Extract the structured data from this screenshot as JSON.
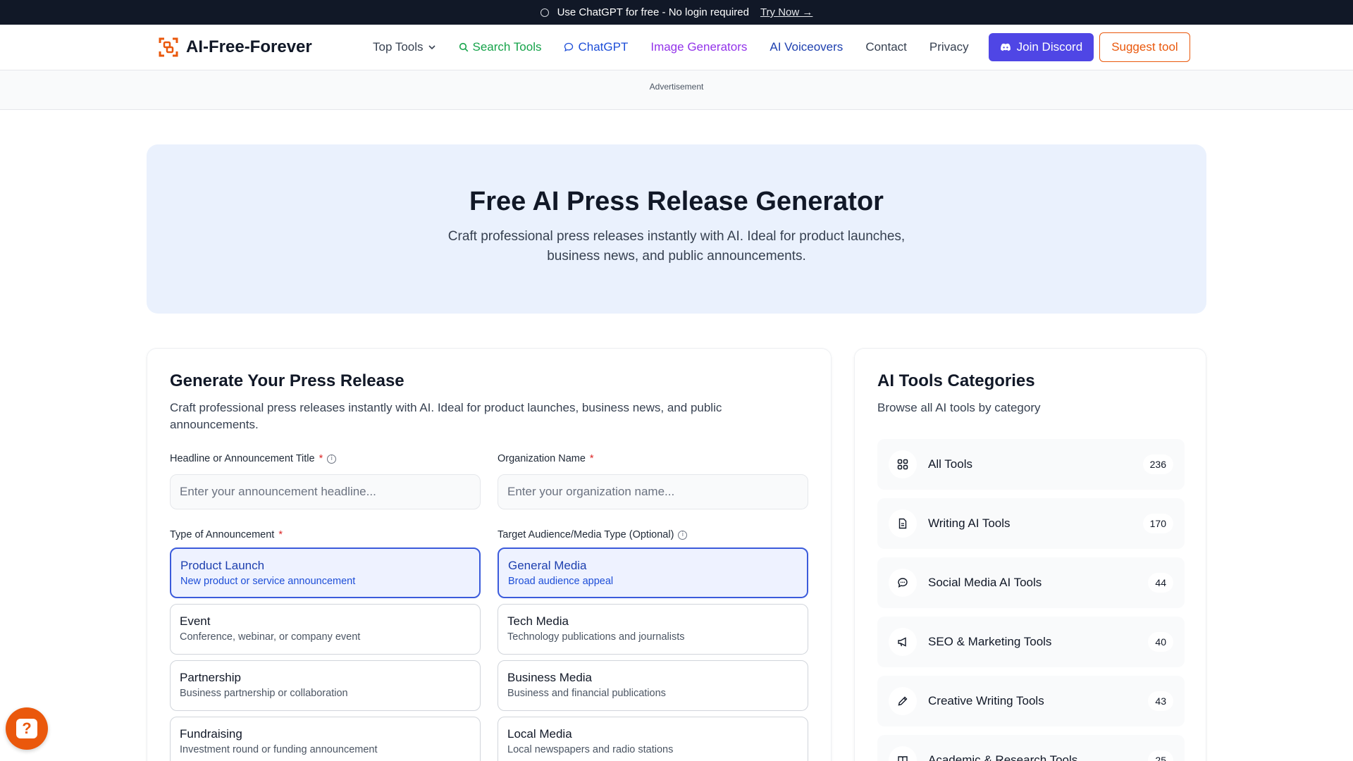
{
  "announcement": {
    "text": "Use ChatGPT for free - No login required",
    "link": "Try Now →"
  },
  "brand": {
    "name": "AI-Free-Forever",
    "accent": "#ea580c"
  },
  "nav": {
    "top_tools": "Top Tools",
    "search_tools": "Search Tools",
    "chatgpt": "ChatGPT",
    "image_generators": "Image Generators",
    "ai_voiceovers": "AI Voiceovers",
    "contact": "Contact",
    "privacy": "Privacy",
    "join_discord": "Join Discord",
    "suggest_tool": "Suggest tool"
  },
  "ad": {
    "label": "Advertisement"
  },
  "hero": {
    "title": "Free AI Press Release Generator",
    "subtitle": "Craft professional press releases instantly with AI. Ideal for product launches, business news, and public announcements."
  },
  "form": {
    "title": "Generate Your Press Release",
    "description": "Craft professional press releases instantly with AI. Ideal for product launches, business news, and public announcements.",
    "headline_label": "Headline or Announcement Title",
    "headline_placeholder": "Enter your announcement headline...",
    "org_label": "Organization Name",
    "org_placeholder": "Enter your organization name...",
    "required_mark": "*",
    "type_label": "Type of Announcement",
    "audience_label": "Target Audience/Media Type (Optional)",
    "announcement_types": [
      {
        "title": "Product Launch",
        "subtitle": "New product or service announcement",
        "selected": true
      },
      {
        "title": "Event",
        "subtitle": "Conference, webinar, or company event",
        "selected": false
      },
      {
        "title": "Partnership",
        "subtitle": "Business partnership or collaboration",
        "selected": false
      },
      {
        "title": "Fundraising",
        "subtitle": "Investment round or funding announcement",
        "selected": false
      }
    ],
    "audiences": [
      {
        "title": "General Media",
        "subtitle": "Broad audience appeal",
        "selected": true
      },
      {
        "title": "Tech Media",
        "subtitle": "Technology publications and journalists",
        "selected": false
      },
      {
        "title": "Business Media",
        "subtitle": "Business and financial publications",
        "selected": false
      },
      {
        "title": "Local Media",
        "subtitle": "Local newspapers and radio stations",
        "selected": false
      }
    ]
  },
  "categories": {
    "title": "AI Tools Categories",
    "subtitle": "Browse all AI tools by category",
    "items": [
      {
        "label": "All Tools",
        "count": "236",
        "icon": "grid-icon"
      },
      {
        "label": "Writing AI Tools",
        "count": "170",
        "icon": "document-icon"
      },
      {
        "label": "Social Media AI Tools",
        "count": "44",
        "icon": "chat-bubble-icon"
      },
      {
        "label": "SEO & Marketing Tools",
        "count": "40",
        "icon": "megaphone-icon"
      },
      {
        "label": "Creative Writing Tools",
        "count": "43",
        "icon": "pencil-icon"
      },
      {
        "label": "Academic & Research Tools",
        "count": "25",
        "icon": "book-icon"
      }
    ]
  },
  "help": {
    "label": "?"
  }
}
